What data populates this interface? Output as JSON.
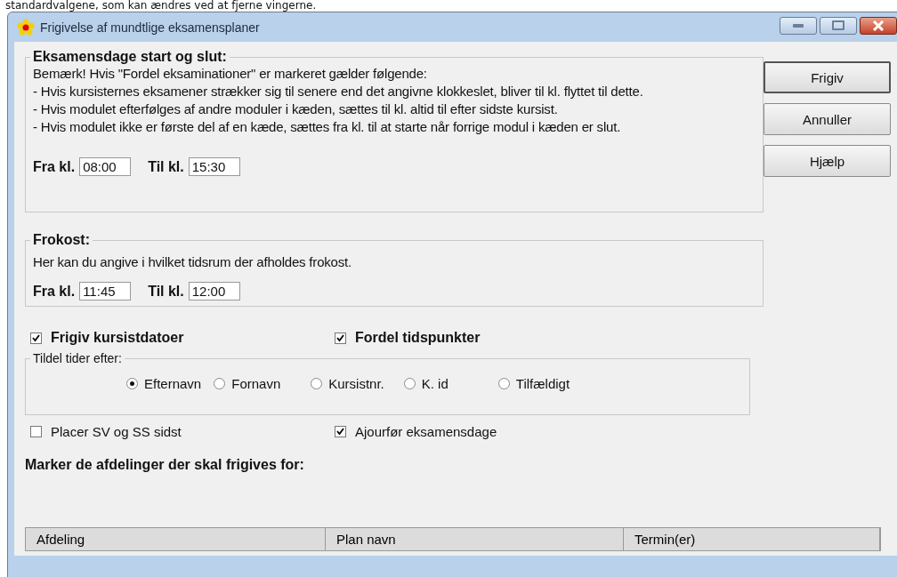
{
  "page_text": "standardvalgene, som kan ændres ved at fjerne vingerne.",
  "window": {
    "title": "Frigivelse af mundtlige eksamensplaner"
  },
  "exam_days": {
    "title": "Eksamensdage start og slut:",
    "notes": [
      "Bemærk! Hvis \"Fordel eksaminationer\" er markeret gælder følgende:",
      "- Hvis kursisternes eksamener strækker sig til senere end det angivne klokkeslet, bliver til kl. flyttet til dette.",
      "- Hvis modulet efterfølges af andre moduler i kæden, sættes til kl. altid til efter sidste kursist.",
      "- Hvis modulet ikke er første del af en kæde, sættes fra kl. til at starte når forrige modul i kæden er slut."
    ],
    "fields": [
      {
        "label": "Fra kl.",
        "value": "08:00"
      },
      {
        "label": "Til kl.",
        "value": "15:30"
      }
    ]
  },
  "lunch": {
    "title": "Frokost:",
    "note": "Her kan du angive i hvilket tidsrum der afholdes frokost.",
    "fields": [
      {
        "label": "Fra kl.",
        "value": "11:45"
      },
      {
        "label": "Til kl.",
        "value": "12:00"
      }
    ]
  },
  "main_checks": [
    {
      "label": "Frigiv kursistdatoer",
      "checked": true
    },
    {
      "label": "Fordel tidspunkter",
      "checked": true
    }
  ],
  "assign_by": {
    "title": "Tildel tider efter:",
    "options": [
      {
        "label": "Efternavn",
        "selected": true
      },
      {
        "label": "Fornavn",
        "selected": false
      },
      {
        "label": "Kursistnr.",
        "selected": false
      },
      {
        "label": "K. id",
        "selected": false
      },
      {
        "label": "Tilfældigt",
        "selected": false
      }
    ]
  },
  "extra_checks": [
    {
      "label": "Placer SV og SS sidst",
      "checked": false
    },
    {
      "label": "Ajourfør eksamensdage",
      "checked": true
    }
  ],
  "departments": {
    "title": "Marker de afdelinger der skal frigives for:",
    "columns": [
      "Afdeling",
      "Plan navn",
      "Termin(er)"
    ]
  },
  "buttons": [
    {
      "label": "Frigiv",
      "default": true
    },
    {
      "label": "Annuller",
      "default": false
    },
    {
      "label": "Hjælp",
      "default": false
    }
  ]
}
